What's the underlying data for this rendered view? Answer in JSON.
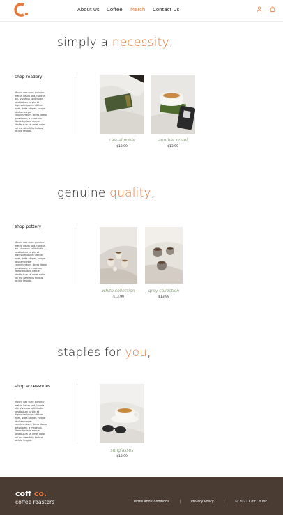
{
  "header": {
    "nav": [
      {
        "label": "About Us",
        "active": false
      },
      {
        "label": "Coffee",
        "active": false
      },
      {
        "label": "Merch",
        "active": true
      },
      {
        "label": "Contact Us",
        "active": false
      }
    ],
    "icons": [
      "user-icon",
      "shopping-bag-icon"
    ]
  },
  "colors": {
    "accent": "#e8783a",
    "caption": "#8aa27e",
    "footer_bg": "#4a3c33"
  },
  "sections": [
    {
      "heading_pre": "simply a ",
      "heading_hl": "necessity",
      "heading_post": ",",
      "side_title": "shop readery",
      "side_desc": "Mauris nec nunc pulvinar, mattis ipsum sed, facilisis dui. Vivamus sollicitudin vestibulum turpis, et dignissim ipsum ultrices eget. Nulla aliquet, neque id ullamcorper condimentum, libero libero gravida ex, a maximus libero ligula id neque. Vestibulum sit amet dolor vel est dam felis finibus lacinia feugiat.",
      "products": [
        {
          "name": "casual novel",
          "price": "$13.99"
        },
        {
          "name": "another novel",
          "price": "$13.99"
        }
      ]
    },
    {
      "heading_pre": "genuine ",
      "heading_hl": "quality",
      "heading_post": ",",
      "side_title": "shop pottery",
      "side_desc": "Mauris nec nunc pulvinar, mattis ipsum sed, facilisis dui. Vivamus sollicitudin vestibulum turpis, et dignissim ipsum ultrices eget. Nulla aliquet, neque id ullamcorper condimentum, libero libero gravida ex, a maximus libero ligula id neque. Vestibulum sit amet dolor vel est dam felis finibus lacinia feugiat.",
      "products": [
        {
          "name": "white collection",
          "price": "$13.99"
        },
        {
          "name": "grey collection",
          "price": "$13.99"
        }
      ]
    },
    {
      "heading_pre": "staples for ",
      "heading_hl": "you",
      "heading_post": ",",
      "side_title": "shop accessories",
      "side_desc": "Mauris nec nunc pulvinar, mattis ipsum sed, lacinia elit. Vivamus sollicitudin vestibulum turpis, et dignissim ipsum ultrices eget. Nulla aliquet, neque id ullamcorper condimentum, libero libero gravida ex, a maximus libero ligula id neque. Vestibulum sit amet dolor vel est dam felis finibus lacinia feugiat.",
      "products": [
        {
          "name": "sunglasses",
          "price": "$13.99"
        }
      ]
    }
  ],
  "footer": {
    "brand_pre": "coff ",
    "brand_hl": "co.",
    "subtitle": "coffee roasters",
    "links": [
      "Terms and Conditions",
      "Privacy Policy"
    ],
    "separator": "|",
    "copyright": "© 2021 Coff Co Inc."
  }
}
